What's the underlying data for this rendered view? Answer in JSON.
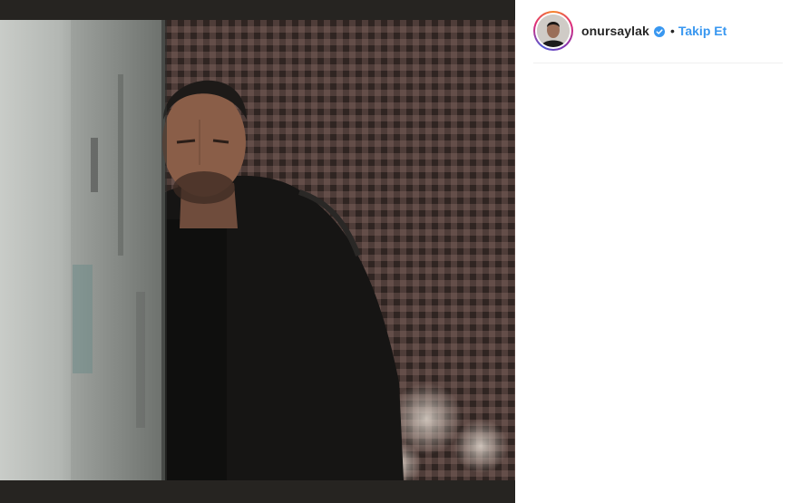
{
  "post": {
    "username": "onursaylak",
    "separator": "•",
    "follow_label": "Takip Et"
  },
  "icons": {
    "verified": "verified-badge-icon",
    "avatar": "profile-avatar"
  },
  "colors": {
    "link": "#3897f0",
    "verified": "#3897f0",
    "media_background": "#262421"
  }
}
